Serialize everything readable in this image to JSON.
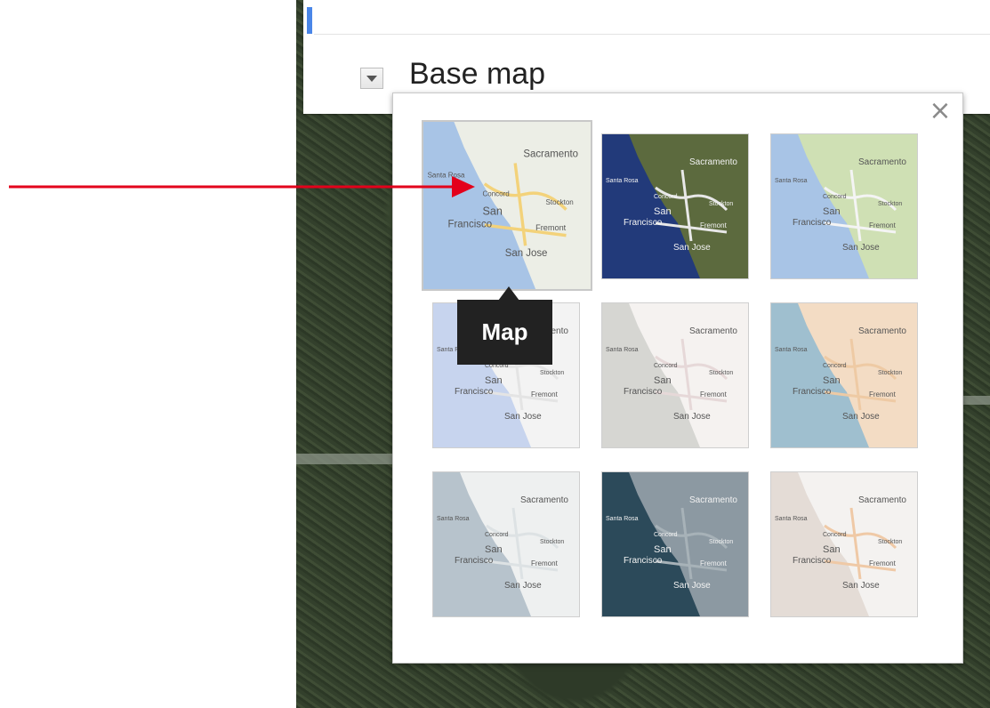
{
  "header": {
    "section_title": "Base map"
  },
  "popup": {
    "close_glyph": "×",
    "tooltip": "Map",
    "styles": [
      {
        "id": "map",
        "selected": true,
        "water": "#a8c4e6",
        "land": "#eceee6",
        "roads": "#f3d27a"
      },
      {
        "id": "satellite",
        "selected": false,
        "water": "#223a7a",
        "land": "#5c6a3e",
        "roads": "#e8e8e8"
      },
      {
        "id": "terrain",
        "selected": false,
        "water": "#a8c4e6",
        "land": "#cfe0b4",
        "roads": "#f4f4f4"
      },
      {
        "id": "light-blue",
        "selected": false,
        "water": "#c7d4ee",
        "land": "#f3f3f3",
        "roads": "#e4e4e4"
      },
      {
        "id": "grayscale",
        "selected": false,
        "water": "#d6d6d2",
        "land": "#f5f2f0",
        "roads": "#e6d8d8"
      },
      {
        "id": "desert",
        "selected": false,
        "water": "#9fbfcf",
        "land": "#f3dcc4",
        "roads": "#eecaa4"
      },
      {
        "id": "blue-gray",
        "selected": false,
        "water": "#b7c3cc",
        "land": "#eef0f0",
        "roads": "#dde2e4"
      },
      {
        "id": "dark-slate",
        "selected": false,
        "water": "#2c4a5a",
        "land": "#8c99a2",
        "roads": "#a7b2b8"
      },
      {
        "id": "light-tan",
        "selected": false,
        "water": "#e4dcd6",
        "land": "#f4f2f0",
        "roads": "#efc9a6"
      }
    ],
    "map_labels": {
      "sacramento": "Sacramento",
      "santa_rosa": "Santa Rosa",
      "concord": "Concord",
      "stockton": "Stockton",
      "san": "San",
      "francisco": "Francisco",
      "fremont": "Fremont",
      "san_jose": "San Jose"
    }
  },
  "colors": {
    "accent": "#4a86e8",
    "pointer_arrow": "#e3001b"
  }
}
